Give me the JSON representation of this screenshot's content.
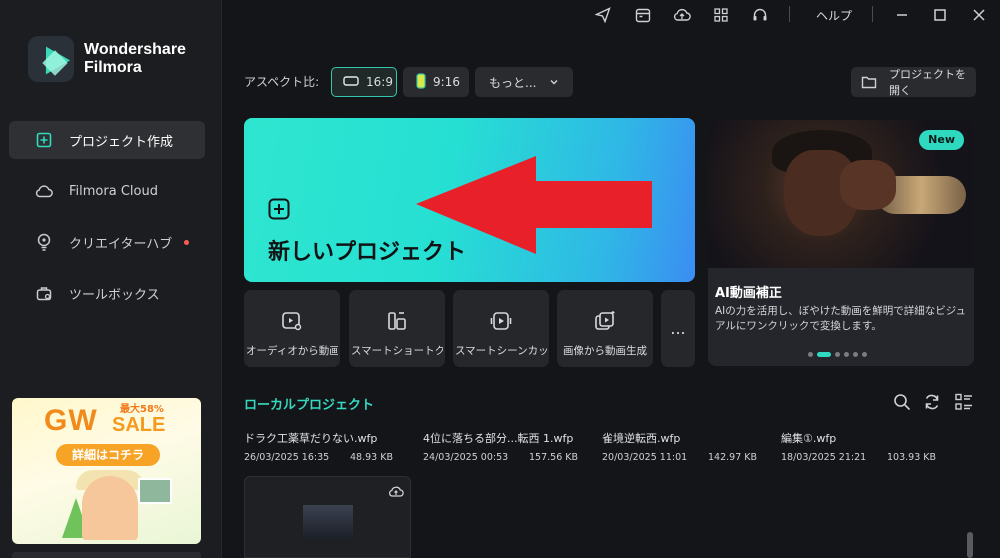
{
  "brand": {
    "line1": "Wondershare",
    "line2": "Filmora"
  },
  "nav": [
    {
      "label": "プロジェクト作成",
      "icon": "new-project-icon",
      "active": true
    },
    {
      "label": "Filmora Cloud",
      "icon": "cloud-icon"
    },
    {
      "label": "クリエイターハブ",
      "icon": "bulb-icon",
      "dot": true
    },
    {
      "label": "ツールボックス",
      "icon": "toolbox-icon"
    }
  ],
  "promo": {
    "gw": "GW",
    "sale": "SALE",
    "percent": "最大58%",
    "cta": "詳細はコチラ"
  },
  "titlebar": {
    "help": "ヘルプ"
  },
  "aspect": {
    "label": "アスペクト比:",
    "options": [
      "16:9",
      "9:16",
      "もっと..."
    ],
    "selected": "16:9"
  },
  "open_project": "プロジェクトを開く",
  "new_project": "新しいプロジェクト",
  "banner": {
    "badge": "New",
    "title": "AI動画補正",
    "desc": "AIの力を活用し、ぼやけた動画を鮮明で詳細なビジュアルにワンクリックで変換します。",
    "dots": 6,
    "active_dot": 1
  },
  "tools": [
    {
      "label": "オーディオから動画",
      "icon": "audio-video-icon"
    },
    {
      "label": "スマートショートク…",
      "icon": "smart-short-icon"
    },
    {
      "label": "スマートシーンカット",
      "icon": "scene-cut-icon"
    },
    {
      "label": "画像から動画生成",
      "icon": "image-video-icon"
    }
  ],
  "more_tools": "...",
  "local_projects": {
    "title": "ローカルプロジェクト",
    "items": [
      {
        "name": "ドラク工薬草だりない.wfp",
        "date": "26/03/2025 16:35",
        "size": "48.93 KB"
      },
      {
        "name": "4位に落ちる部分...転西 1.wfp",
        "date": "24/03/2025 00:53",
        "size": "157.56 KB"
      },
      {
        "name": "雀境逆転西.wfp",
        "date": "20/03/2025 11:01",
        "size": "142.97 KB"
      },
      {
        "name": "編集①.wfp",
        "date": "18/03/2025 21:21",
        "size": "103.93 KB"
      }
    ]
  },
  "colors": {
    "accent": "#2fd9c0",
    "arrow": "#e8202a",
    "bg": "#141518"
  }
}
